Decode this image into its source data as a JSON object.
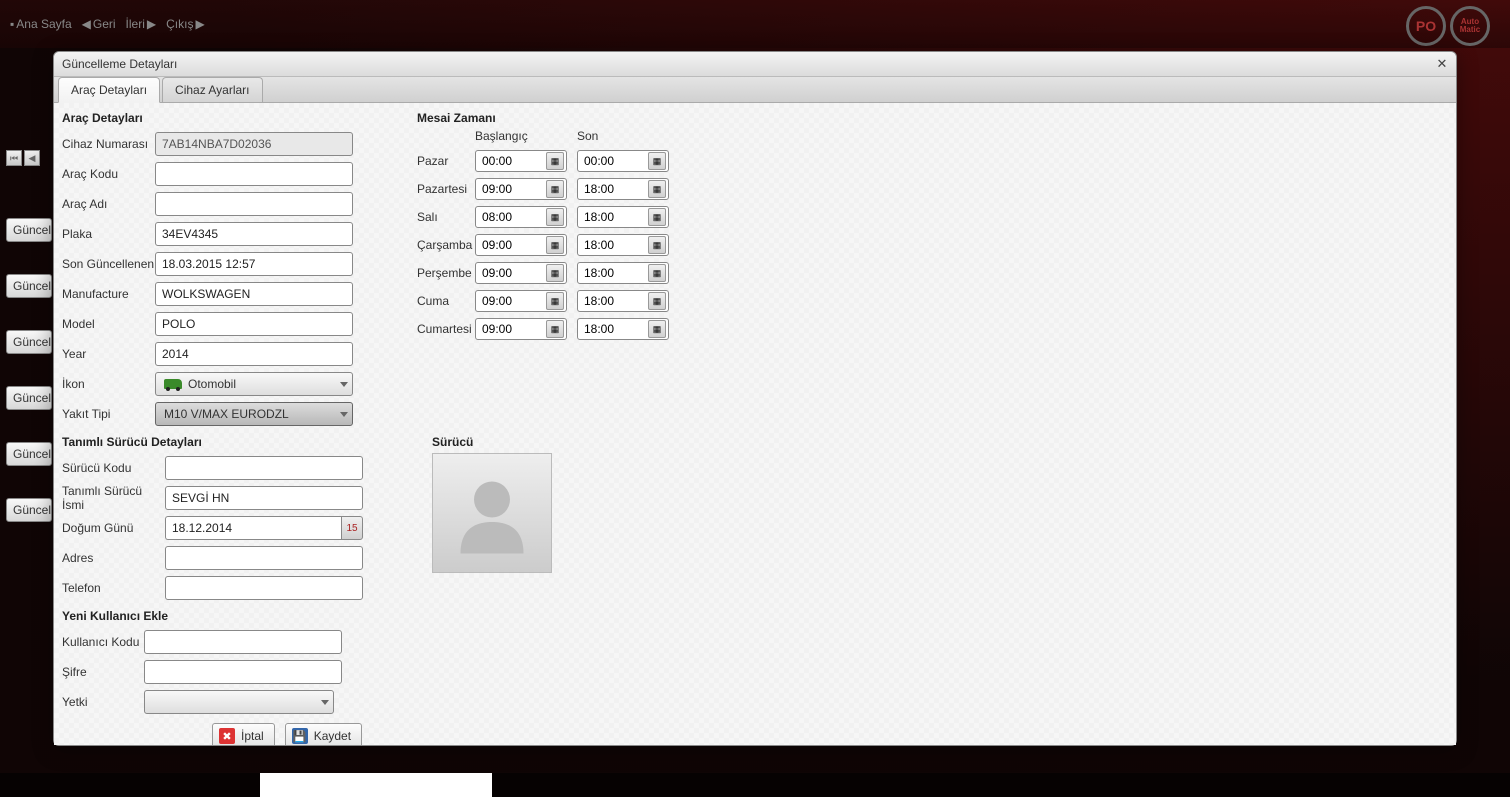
{
  "nav": {
    "home": "Ana Sayfa",
    "back": "Geri",
    "forward": "İleri",
    "exit": "Çıkış"
  },
  "logo": {
    "po": "PO",
    "auto1": "Auto",
    "auto2": "Matic"
  },
  "bg": {
    "btn": "Güncelle",
    "pager_first": "⏮",
    "pager_prev": "◀"
  },
  "modal": {
    "title": "Güncelleme Detayları",
    "tabs": {
      "t1": "Araç Detayları",
      "t2": "Cihaz Ayarları"
    },
    "cancel": "İptal",
    "save": "Kaydet"
  },
  "vehicle": {
    "section": "Araç Detayları",
    "labels": {
      "deviceNo": "Cihaz Numarası",
      "vehicleCode": "Araç Kodu",
      "vehicleName": "Araç Adı",
      "plate": "Plaka",
      "lastUpdated": "Son Güncellenen",
      "manufacture": "Manufacture",
      "model": "Model",
      "year": "Year",
      "icon": "İkon",
      "fuel": "Yakıt Tipi"
    },
    "values": {
      "deviceNo": "7AB14NBA7D02036",
      "vehicleCode": "",
      "vehicleName": "",
      "plate": "34EV4345",
      "lastUpdated": "18.03.2015 12:57",
      "manufacture": "WOLKSWAGEN",
      "model": "POLO",
      "year": "2014",
      "icon": "Otomobil",
      "fuel": "M10 V/MAX EURODZL"
    }
  },
  "hours": {
    "section": "Mesai Zamanı",
    "head": {
      "start": "Başlangıç",
      "end": "Son"
    },
    "days": {
      "pazar": "Pazar",
      "pazartesi": "Pazartesi",
      "sali": "Salı",
      "carsamba": "Çarşamba",
      "persembe": "Perşembe",
      "cuma": "Cuma",
      "cumartesi": "Cumartesi"
    },
    "values": {
      "pazar": {
        "s": "00:00",
        "e": "00:00"
      },
      "pazartesi": {
        "s": "09:00",
        "e": "18:00"
      },
      "sali": {
        "s": "08:00",
        "e": "18:00"
      },
      "carsamba": {
        "s": "09:00",
        "e": "18:00"
      },
      "persembe": {
        "s": "09:00",
        "e": "18:00"
      },
      "cuma": {
        "s": "09:00",
        "e": "18:00"
      },
      "cumartesi": {
        "s": "09:00",
        "e": "18:00"
      }
    }
  },
  "driver": {
    "section": "Tanımlı Sürücü Detayları",
    "photoLabel": "Sürücü",
    "labels": {
      "code": "Sürücü Kodu",
      "name": "Tanımlı Sürücü İsmi",
      "dob": "Doğum Günü",
      "address": "Adres",
      "phone": "Telefon"
    },
    "values": {
      "code": "",
      "name": "SEVGİ HN",
      "dob": "18.12.2014",
      "address": "",
      "phone": ""
    },
    "cal": "15"
  },
  "user": {
    "section": "Yeni Kullanıcı Ekle",
    "labels": {
      "code": "Kullanıcı Kodu",
      "pass": "Şifre",
      "role": "Yetki"
    },
    "values": {
      "code": "",
      "pass": "",
      "role": ""
    }
  }
}
